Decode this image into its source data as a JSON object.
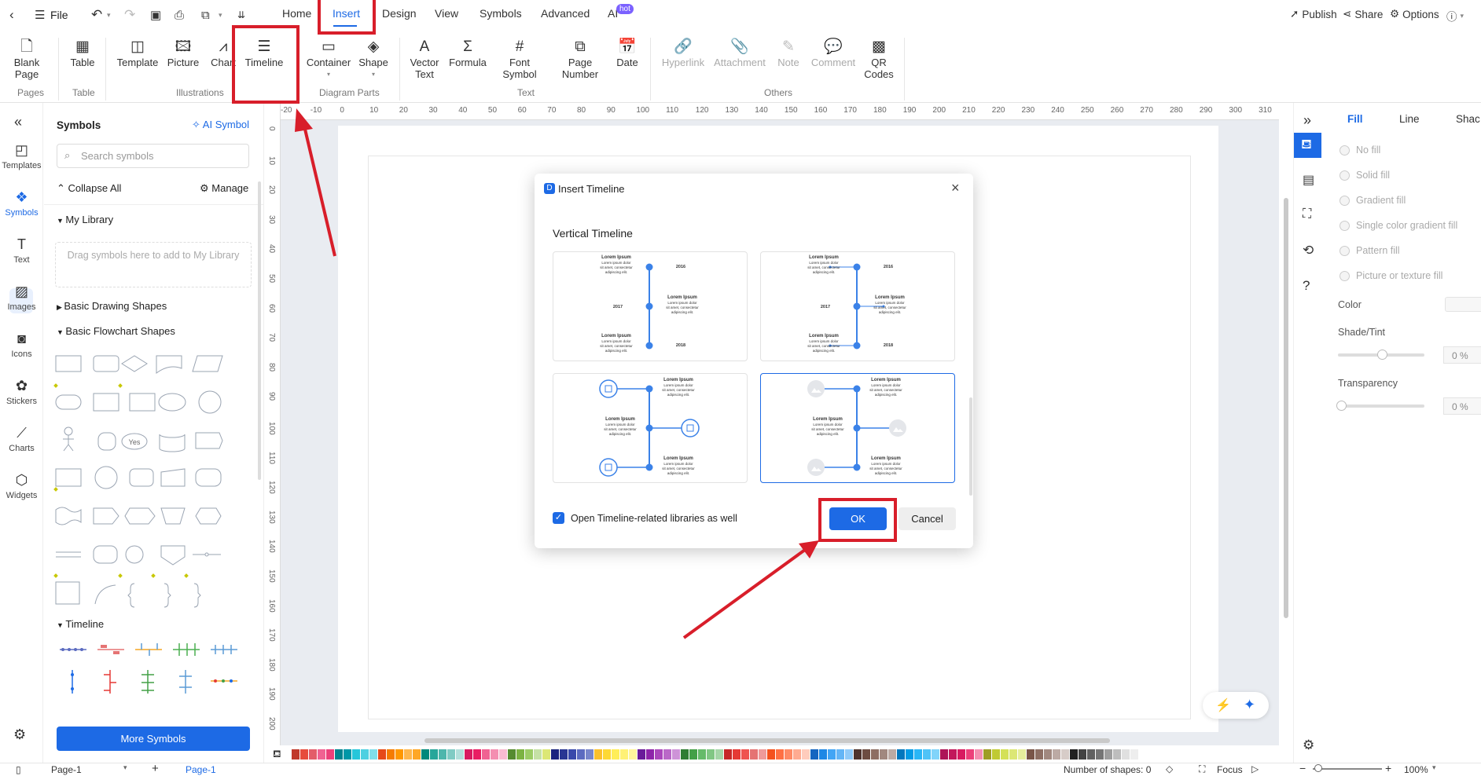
{
  "topbar": {
    "file_label": "File",
    "tabs": [
      "Home",
      "Insert",
      "Design",
      "View",
      "Symbols",
      "Advanced",
      "AI"
    ],
    "hot_badge": "hot",
    "publish": "Publish",
    "share": "Share",
    "options": "Options"
  },
  "ribbon": {
    "blank_page": "Blank Page",
    "table": "Table",
    "template": "Template",
    "picture": "Picture",
    "chart": "Chart",
    "timeline": "Timeline",
    "container": "Container",
    "shape": "Shape",
    "vector_text": "Vector Text",
    "formula": "Formula",
    "font_symbol": "Font Symbol",
    "page_number": "Page Number",
    "date": "Date",
    "hyperlink": "Hyperlink",
    "attachment": "Attachment",
    "note": "Note",
    "comment": "Comment",
    "qr_codes": "QR Codes",
    "groups": {
      "pages": "Pages",
      "table": "Table",
      "illustrations": "Illustrations",
      "diagram_parts": "Diagram Parts",
      "text": "Text",
      "others": "Others"
    }
  },
  "left_rail": [
    "Templates",
    "Symbols",
    "Text",
    "Images",
    "Icons",
    "Stickers",
    "Charts",
    "Widgets"
  ],
  "symbols_panel": {
    "title": "Symbols",
    "ai_symbol": "AI Symbol",
    "search_placeholder": "Search symbols",
    "collapse_all": "Collapse All",
    "manage": "Manage",
    "my_library": "My Library",
    "drop_hint": "Drag symbols here to add to My Library",
    "basic_drawing": "Basic Drawing Shapes",
    "basic_flowchart": "Basic Flowchart Shapes",
    "yes_shape": "Yes",
    "timeline": "Timeline",
    "more_symbols": "More Symbols"
  },
  "ruler": {
    "h": [
      "-20",
      "-10",
      "0",
      "10",
      "20",
      "30",
      "40",
      "50",
      "60",
      "70",
      "80",
      "90",
      "100",
      "110",
      "120",
      "130",
      "140",
      "150",
      "160",
      "170",
      "180",
      "190",
      "200",
      "210",
      "220",
      "230",
      "240",
      "250",
      "260",
      "270",
      "280",
      "290",
      "300",
      "310"
    ],
    "v": [
      "0",
      "10",
      "20",
      "30",
      "40",
      "50",
      "60",
      "70",
      "80",
      "90",
      "100",
      "110",
      "120",
      "130",
      "140",
      "150",
      "160",
      "170",
      "180",
      "190",
      "200"
    ]
  },
  "dialog": {
    "title": "Insert Timeline",
    "section": "Vertical Timeline",
    "card_title": "Lorem Ipsum",
    "card_body": "Lorem ipsum dolor sit amet, consectetur adipiscing elit.",
    "year_a": "2016",
    "year_b": "2017",
    "year_c": "2018",
    "checkbox_label": "Open Timeline-related libraries as well",
    "ok": "OK",
    "cancel": "Cancel"
  },
  "right_panel": {
    "tabs": [
      "Fill",
      "Line",
      "Shac"
    ],
    "fill_options": [
      "No fill",
      "Solid fill",
      "Gradient fill",
      "Single color gradient fill",
      "Pattern fill",
      "Picture or texture fill"
    ],
    "color": "Color",
    "shade_tint": "Shade/Tint",
    "shade_value": "0 %",
    "transparency": "Transparency",
    "transparency_value": "0 %"
  },
  "bottombar": {
    "page_select": "Page-1",
    "page_tab": "Page-1",
    "shapes_count": "Number of shapes: 0",
    "focus": "Focus",
    "zoom": "100%"
  },
  "colors": {
    "accent": "#1d6ae5",
    "annotation_red": "#d81e2a",
    "palette": [
      "#c0392b",
      "#e74c3c",
      "#e35d6a",
      "#f06292",
      "#ec407a",
      "#00838f",
      "#0097a7",
      "#26c6da",
      "#4dd0e1",
      "#80deea",
      "#e64a19",
      "#f57c00",
      "#ff9800",
      "#ffb74d",
      "#ffa726",
      "#00897b",
      "#26a69a",
      "#4db6ac",
      "#80cbc4",
      "#b2dfdb",
      "#d81b60",
      "#e91e63",
      "#f06292",
      "#f48fb1",
      "#f8bbd0",
      "#558b2f",
      "#7cb342",
      "#9ccc65",
      "#c5e1a5",
      "#dce775",
      "#1a237e",
      "#283593",
      "#3949ab",
      "#5c6bc0",
      "#7986cb",
      "#fbc02d",
      "#fdd835",
      "#ffee58",
      "#fff176",
      "#fff59d",
      "#6a1b9a",
      "#8e24aa",
      "#ab47bc",
      "#ba68c8",
      "#ce93d8",
      "#2e7d32",
      "#43a047",
      "#66bb6a",
      "#81c784",
      "#a5d6a7",
      "#c62828",
      "#e53935",
      "#ef5350",
      "#e57373",
      "#ef9a9a",
      "#f4511e",
      "#ff7043",
      "#ff8a65",
      "#ffab91",
      "#ffccbc",
      "#1565c0",
      "#1e88e5",
      "#42a5f5",
      "#64b5f6",
      "#90caf9",
      "#4e342e",
      "#6d4c41",
      "#8d6e63",
      "#a1887f",
      "#bcaaa4",
      "#0277bd",
      "#039be5",
      "#29b6f6",
      "#4fc3f7",
      "#81d4fa",
      "#ad1457",
      "#c2185b",
      "#d81b60",
      "#ec407a",
      "#f48fb1",
      "#9e9d24",
      "#c0ca33",
      "#d4e157",
      "#dce775",
      "#e6ee9c",
      "#795548",
      "#8d6e63",
      "#a1887f",
      "#bcaaa4",
      "#d7ccc8",
      "#212121",
      "#424242",
      "#616161",
      "#757575",
      "#9e9e9e",
      "#bdbdbd",
      "#e0e0e0",
      "#eeeeee"
    ]
  }
}
